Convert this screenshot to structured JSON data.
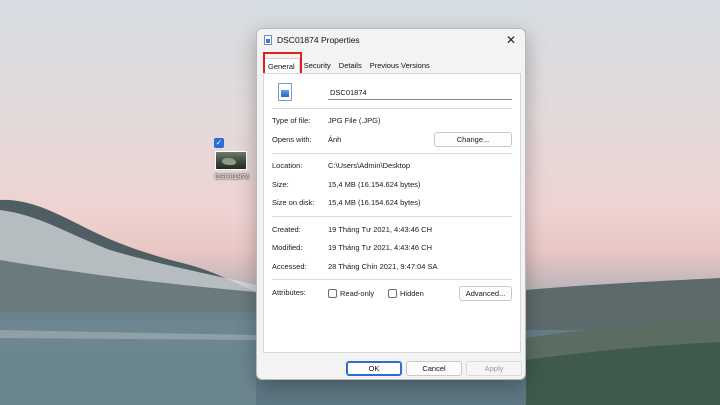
{
  "window": {
    "title": "DSC01874 Properties",
    "close_glyph": "✕"
  },
  "desktop": {
    "icon_label": "DSC01874",
    "check_glyph": "✓"
  },
  "tabs": [
    {
      "label": "General",
      "active": true
    },
    {
      "label": "Security",
      "active": false
    },
    {
      "label": "Details",
      "active": false
    },
    {
      "label": "Previous Versions",
      "active": false
    }
  ],
  "general": {
    "file_name": "DSC01874",
    "type_of_file_label": "Type of file:",
    "type_of_file_value": "JPG File (.JPG)",
    "opens_with_label": "Opens with:",
    "opens_with_value": "Ảnh",
    "change_button": "Change...",
    "location_label": "Location:",
    "location_value": "C:\\Users\\Admin\\Desktop",
    "size_label": "Size:",
    "size_value": "15,4 MB (16.154.624 bytes)",
    "size_on_disk_label": "Size on disk:",
    "size_on_disk_value": "15,4 MB (16.154.624 bytes)",
    "created_label": "Created:",
    "created_value": "19 Tháng Tư 2021, 4:43:46 CH",
    "modified_label": "Modified:",
    "modified_value": "19 Tháng Tư 2021, 4:43:46 CH",
    "accessed_label": "Accessed:",
    "accessed_value": "28 Tháng Chín 2021, 9:47:04 SA",
    "attributes_label": "Attributes:",
    "readonly_label": "Read-only",
    "hidden_label": "Hidden",
    "readonly_checked": false,
    "hidden_checked": false,
    "advanced_button": "Advanced..."
  },
  "footer": {
    "ok": "OK",
    "cancel": "Cancel",
    "apply": "Apply"
  },
  "colors": {
    "highlight": "#e0201c",
    "ok_border": "#2a6fd0",
    "desktop_icon_check": "#2b6cd6"
  }
}
